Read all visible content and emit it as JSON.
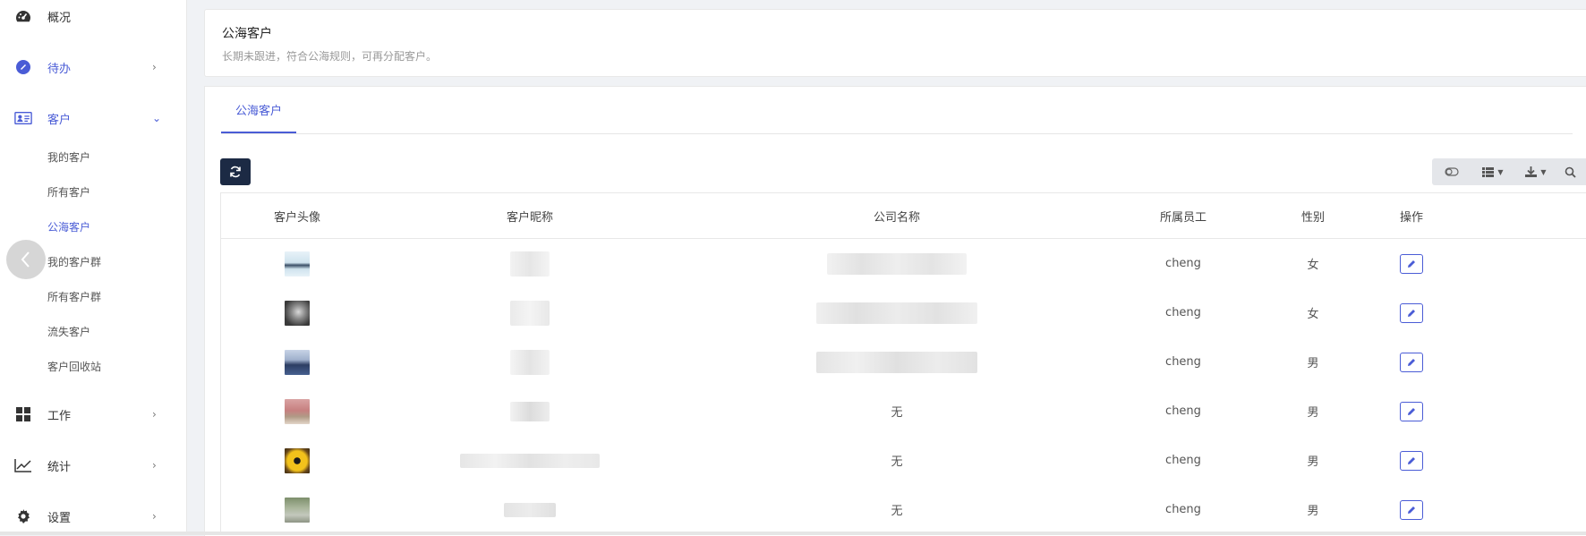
{
  "sidebar": {
    "items": [
      {
        "label": "概况",
        "icon": "dashboard-icon"
      },
      {
        "label": "待办",
        "icon": "todo-icon"
      },
      {
        "label": "客户",
        "icon": "contact-card-icon"
      },
      {
        "label": "工作",
        "icon": "grid-icon"
      },
      {
        "label": "统计",
        "icon": "chart-line-icon"
      },
      {
        "label": "设置",
        "icon": "gear-icon"
      }
    ],
    "sub_items": [
      "我的客户",
      "所有客户",
      "公海客户",
      "我的客户群",
      "所有客户群",
      "流失客户",
      "客户回收站"
    ]
  },
  "header": {
    "title": "公海客户",
    "subtitle": "长期未跟进，符合公海规则，可再分配客户。"
  },
  "tabs": [
    {
      "label": "公海客户"
    }
  ],
  "table": {
    "columns": [
      "客户头像",
      "客户昵称",
      "公司名称",
      "所属员工",
      "性别",
      "操作"
    ],
    "rows": [
      {
        "company": "",
        "employee": "cheng",
        "gender": "女"
      },
      {
        "company": "",
        "employee": "cheng",
        "gender": "女"
      },
      {
        "company": "",
        "employee": "cheng",
        "gender": "男"
      },
      {
        "company": "无",
        "employee": "cheng",
        "gender": "男"
      },
      {
        "company": "无",
        "employee": "cheng",
        "gender": "男"
      },
      {
        "company": "无",
        "employee": "cheng",
        "gender": "男"
      }
    ]
  },
  "colors": {
    "accent": "#4a5cd6",
    "dark_button": "#1c2a44"
  }
}
